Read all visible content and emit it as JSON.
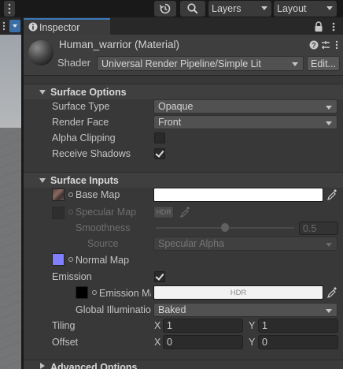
{
  "toolbar": {
    "history_icon": "history-icon",
    "search_icon": "search-icon",
    "layers_label": "Layers",
    "layout_label": "Layout"
  },
  "inspector": {
    "tab_label": "Inspector",
    "tab_icon": "info-icon",
    "material_title": "Human_warrior (Material)",
    "shader_label": "Shader",
    "shader_value": "Universal Render Pipeline/Simple Lit",
    "edit_button": "Edit..."
  },
  "surface_options": {
    "title": "Surface Options",
    "surface_type_label": "Surface Type",
    "surface_type_value": "Opaque",
    "render_face_label": "Render Face",
    "render_face_value": "Front",
    "alpha_clipping_label": "Alpha Clipping",
    "alpha_clipping_checked": false,
    "receive_shadows_label": "Receive Shadows",
    "receive_shadows_checked": true
  },
  "surface_inputs": {
    "title": "Surface Inputs",
    "base_map_label": "Base Map",
    "specular_map_label": "Specular Map",
    "specular_hdr": "HDR",
    "smoothness_label": "Smoothness",
    "smoothness_value": "0.5",
    "smoothness_fraction": 0.5,
    "source_label": "Source",
    "source_value": "Specular Alpha",
    "normal_map_label": "Normal Map",
    "emission_label": "Emission",
    "emission_checked": true,
    "emission_map_label": "Emission Ma",
    "emission_hdr": "HDR",
    "gi_label": "Global Illuminatio",
    "gi_value": "Baked",
    "tiling_label": "Tiling",
    "tiling_x_label": "X",
    "tiling_x": "1",
    "tiling_y_label": "Y",
    "tiling_y": "1",
    "offset_label": "Offset",
    "offset_x_label": "X",
    "offset_x": "0",
    "offset_y_label": "Y",
    "offset_y": "0"
  },
  "advanced_options": {
    "title": "Advanced Options"
  },
  "colors": {
    "accent": "#3a79bb",
    "normal_map_swatch": "#8080ff",
    "emission_swatch": "#000000",
    "base_map_swatch": "#ffffff"
  }
}
